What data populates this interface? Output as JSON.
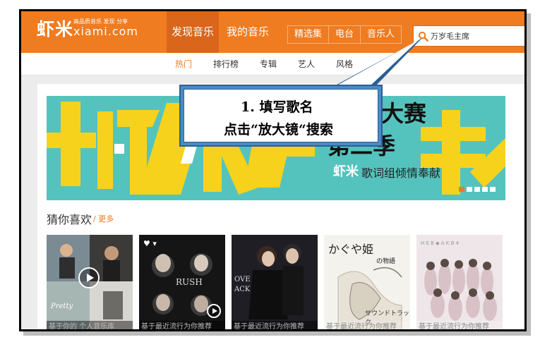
{
  "header": {
    "logo_text": "虾米",
    "logo_tagline": "高品质音乐 发现 分享",
    "logo_domain": "xiami.com",
    "nav_discover": "发现音乐",
    "nav_mine": "我的音乐",
    "pill_featured": "精选集",
    "pill_radio": "电台",
    "pill_artists": "音乐人",
    "search_value": "万岁毛主席",
    "search_icon": "search-icon"
  },
  "subnav": {
    "hot": "热门",
    "charts": "排行榜",
    "albums": "专辑",
    "artists": "艺人",
    "genres": "风格"
  },
  "banner": {
    "headline_1": "大赛",
    "headline_2": "第二季",
    "brand": "虾米",
    "slogan": "歌词组倾情奉献",
    "slides": 5,
    "active_slide": 1
  },
  "recommend": {
    "title": "猜你喜欢",
    "more": "/ 更多",
    "cards": [
      {
        "caption": "基于你的 个人音乐库"
      },
      {
        "caption": "基于最近流行为你推荐"
      },
      {
        "caption": "基于最近流行为你推荐"
      },
      {
        "caption": "基于最近流行为你推荐"
      },
      {
        "caption": "基于最近流行为你推荐"
      }
    ],
    "album_title_3": "サウンドトラック",
    "album_art_2": "RUSH"
  },
  "callout": {
    "line1": "1. 填写歌名",
    "line2": "点击“放大镜“搜索"
  },
  "colors": {
    "brand_orange": "#ef7c21",
    "banner_teal": "#55c3bd",
    "banner_yellow": "#f7d21c",
    "callout_blue": "#4a8ac7"
  }
}
